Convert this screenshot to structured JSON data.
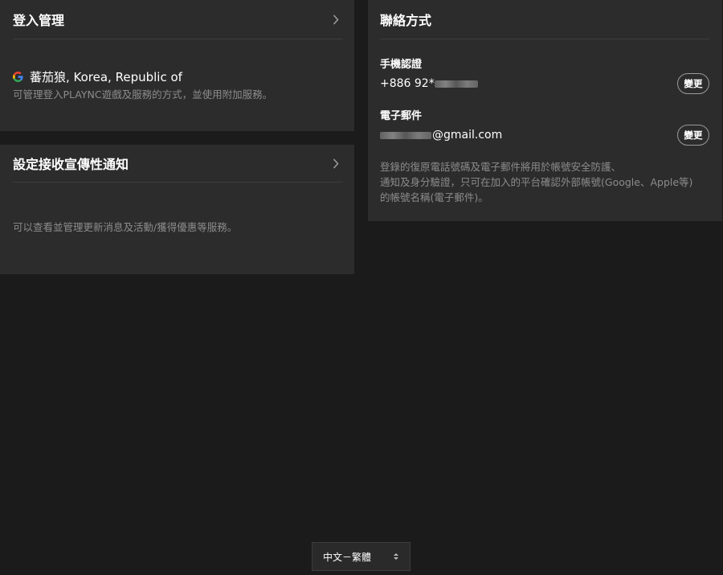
{
  "login_management": {
    "title": "登入管理",
    "account_name": "蕃茄狼, Korea, Republic of",
    "provider_icon": "google-icon",
    "description": "可管理登入PLAYNC遊戲及服務的方式，並使用附加服務。"
  },
  "notification_settings": {
    "title": "設定接收宣傳性通知",
    "description": "可以查看並管理更新消息及活動/獲得優惠等服務。"
  },
  "contact": {
    "title": "聯絡方式",
    "phone": {
      "label": "手機認證",
      "value_prefix": "+886 92*",
      "change_label": "變更"
    },
    "email": {
      "label": "電子郵件",
      "value_suffix": "@gmail.com",
      "change_label": "變更"
    },
    "description_lines": [
      "登錄的復原電話號碼及電子郵件將用於帳號安全防護、",
      "通知及身分驗證，只可在加入的平台確認外部帳號(Google、Apple等)",
      "的帳號名稱(電子郵件)。"
    ]
  },
  "language_select": {
    "selected": "中文－繁體"
  }
}
